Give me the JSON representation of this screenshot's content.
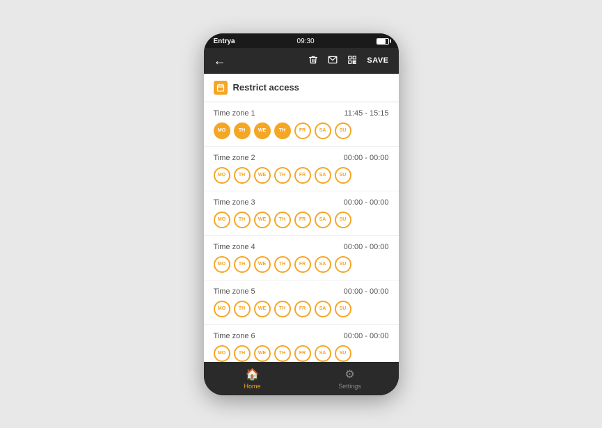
{
  "status_bar": {
    "app_name": "Entrya",
    "wifi_icon": "wifi",
    "time": "09:30",
    "battery": "full"
  },
  "toolbar": {
    "back_label": "←",
    "delete_icon": "🗑",
    "mail_icon": "✉",
    "qr_icon": "qr",
    "save_label": "SAVE"
  },
  "restrict_header": {
    "icon_label": "📅",
    "title": "Restrict access"
  },
  "time_zones": [
    {
      "label": "Time zone 1",
      "time": "11:45 - 15:15",
      "days": [
        {
          "code": "MO",
          "active": true
        },
        {
          "code": "TH",
          "active": true
        },
        {
          "code": "WE",
          "active": true
        },
        {
          "code": "TH",
          "active": true
        },
        {
          "code": "FR",
          "active": false
        },
        {
          "code": "SA",
          "active": false
        },
        {
          "code": "SU",
          "active": false
        }
      ]
    },
    {
      "label": "Time zone 2",
      "time": "00:00 - 00:00",
      "days": [
        {
          "code": "MO",
          "active": false
        },
        {
          "code": "TH",
          "active": false
        },
        {
          "code": "WE",
          "active": false
        },
        {
          "code": "TH",
          "active": false
        },
        {
          "code": "FR",
          "active": false
        },
        {
          "code": "SA",
          "active": false
        },
        {
          "code": "SU",
          "active": false
        }
      ]
    },
    {
      "label": "Time zone 3",
      "time": "00:00 - 00:00",
      "days": [
        {
          "code": "MO",
          "active": false
        },
        {
          "code": "TH",
          "active": false
        },
        {
          "code": "WE",
          "active": false
        },
        {
          "code": "TH",
          "active": false
        },
        {
          "code": "FR",
          "active": false
        },
        {
          "code": "SA",
          "active": false
        },
        {
          "code": "SU",
          "active": false
        }
      ]
    },
    {
      "label": "Time zone 4",
      "time": "00:00 - 00:00",
      "days": [
        {
          "code": "MO",
          "active": false
        },
        {
          "code": "TH",
          "active": false
        },
        {
          "code": "WE",
          "active": false
        },
        {
          "code": "TH",
          "active": false
        },
        {
          "code": "FR",
          "active": false
        },
        {
          "code": "SA",
          "active": false
        },
        {
          "code": "SU",
          "active": false
        }
      ]
    },
    {
      "label": "Time zone 5",
      "time": "00:00 - 00:00",
      "days": [
        {
          "code": "MO",
          "active": false
        },
        {
          "code": "TH",
          "active": false
        },
        {
          "code": "WE",
          "active": false
        },
        {
          "code": "TH",
          "active": false
        },
        {
          "code": "FR",
          "active": false
        },
        {
          "code": "SA",
          "active": false
        },
        {
          "code": "SU",
          "active": false
        }
      ]
    },
    {
      "label": "Time zone 6",
      "time": "00:00 - 00:00",
      "days": [
        {
          "code": "MO",
          "active": false
        },
        {
          "code": "TH",
          "active": false
        },
        {
          "code": "WE",
          "active": false
        },
        {
          "code": "TH",
          "active": false
        },
        {
          "code": "FR",
          "active": false
        },
        {
          "code": "SA",
          "active": false
        },
        {
          "code": "SU",
          "active": false
        }
      ]
    }
  ],
  "bottom_nav": [
    {
      "label": "Home",
      "icon": "🏠",
      "active": true
    },
    {
      "label": "Settings",
      "icon": "⚙",
      "active": false
    }
  ]
}
